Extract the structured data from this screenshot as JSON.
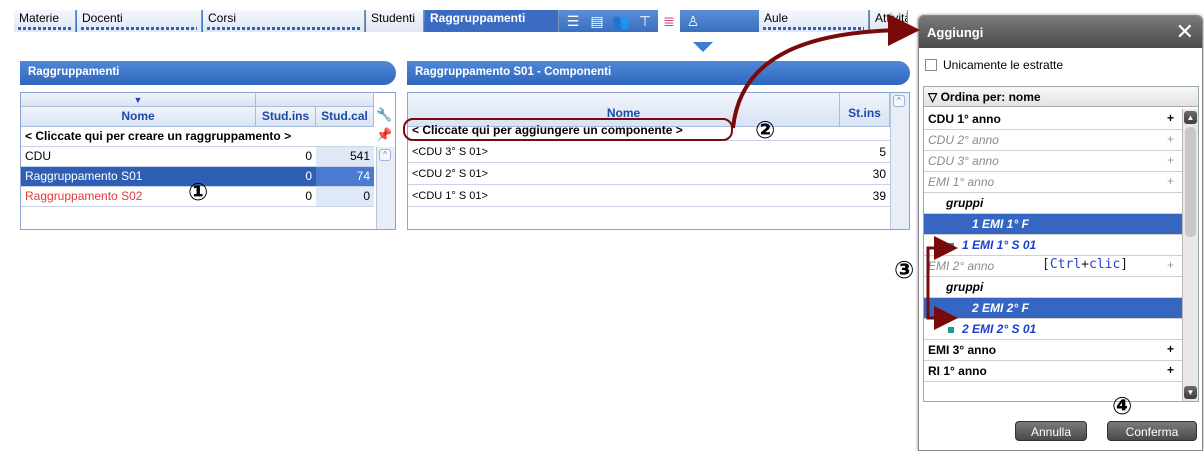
{
  "tabs": {
    "items": [
      {
        "label": "Materie"
      },
      {
        "label": "Docenti"
      },
      {
        "label": "Corsi"
      },
      {
        "label": "Studenti"
      },
      {
        "label": "Raggruppamenti"
      },
      {
        "label": "Aule"
      },
      {
        "label": "Attività"
      }
    ],
    "icons": [
      "list-icon",
      "columns-icon",
      "people-icon",
      "filter-icon",
      "group-list-icon",
      "person-icon"
    ]
  },
  "left": {
    "title": "Raggruppamenti",
    "headers": {
      "name": "Nome",
      "stud_ins": "Stud.ins",
      "stud_cal": "Stud.cal"
    },
    "create_row": "< Cliccate qui per creare un raggruppamento >",
    "rows": [
      {
        "name": "CDU",
        "ins": "0",
        "cal": "541"
      },
      {
        "name": "Raggruppamento S01",
        "ins": "0",
        "cal": "74"
      },
      {
        "name": "Raggruppamento S02",
        "ins": "0",
        "cal": "0"
      }
    ]
  },
  "right": {
    "title": "Raggruppamento S01 - Componenti",
    "headers": {
      "name": "Nome",
      "st_ins": "St.ins"
    },
    "add_row": "< Cliccate qui per aggiungere un componente >",
    "rows": [
      {
        "name": "<CDU 3° S 01>",
        "ins": "5"
      },
      {
        "name": "<CDU 2° S 01>",
        "ins": "30"
      },
      {
        "name": "<CDU 1° S 01>",
        "ins": "39"
      }
    ]
  },
  "dialog": {
    "title": "Aggiungi",
    "checkbox_label": "Unicamente le estratte",
    "sort_label": "Ordina per: nome",
    "items": [
      {
        "label": "CDU 1° anno",
        "plus": "+"
      },
      {
        "label": "CDU 2° anno",
        "plus": "+"
      },
      {
        "label": "CDU 3° anno",
        "plus": "+"
      },
      {
        "label": "EMI 1° anno",
        "plus": "+"
      },
      {
        "label": "gruppi"
      },
      {
        "label": "1 EMI 1° F"
      },
      {
        "label": "1 EMI 1° S 01"
      },
      {
        "label": "EMI 2° anno",
        "plus": "+"
      },
      {
        "label": "gruppi"
      },
      {
        "label": "2 EMI 2° F"
      },
      {
        "label": "2 EMI 2° S 01"
      },
      {
        "label": "EMI 3° anno",
        "plus": "+"
      },
      {
        "label": "RI 1° anno",
        "plus": "+"
      }
    ],
    "shortcut": {
      "open": "[",
      "key1": "Ctrl",
      "sep": "+",
      "key2": "clic",
      "close": "]"
    },
    "cancel": "Annulla",
    "confirm": "Conferma"
  },
  "markers": {
    "m1": "①",
    "m2": "②",
    "m3": "③",
    "m4": "④"
  },
  "colors": {
    "accent": "#2f5fb5",
    "arrow": "#7a0a0a",
    "red_text": "#e23b3b"
  }
}
